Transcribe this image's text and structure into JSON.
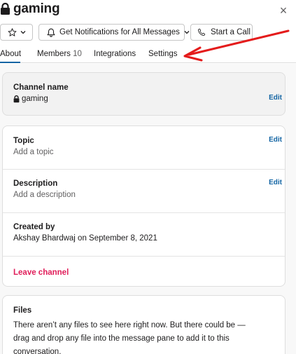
{
  "header": {
    "channel_name": "gaming",
    "close_label": "×"
  },
  "buttons": {
    "notify_label": "Get Notifications for All Messages",
    "call_label": "Start a Call"
  },
  "tabs": [
    {
      "label": "About",
      "count": "",
      "active": true
    },
    {
      "label": "Members",
      "count": "10",
      "active": false
    },
    {
      "label": "Integrations",
      "count": "",
      "active": false
    },
    {
      "label": "Settings",
      "count": "",
      "active": false
    }
  ],
  "channel_card": {
    "title": "Channel name",
    "value": "gaming",
    "edit_label": "Edit"
  },
  "details_card": {
    "topic_title": "Topic",
    "topic_value": "Add a topic",
    "topic_edit": "Edit",
    "description_title": "Description",
    "description_value": "Add a description",
    "description_edit": "Edit",
    "created_title": "Created by",
    "created_value": "Akshay Bhardwaj on September 8, 2021",
    "leave_label": "Leave channel"
  },
  "files_card": {
    "title": "Files",
    "text": "There aren’t any files to see here right now. But there could be — drag and drop any file into the message pane to add it to this conversation."
  },
  "colors": {
    "accent": "#1264a3",
    "danger": "#e01e5a",
    "annotation_arrow": "#e41b1b"
  }
}
